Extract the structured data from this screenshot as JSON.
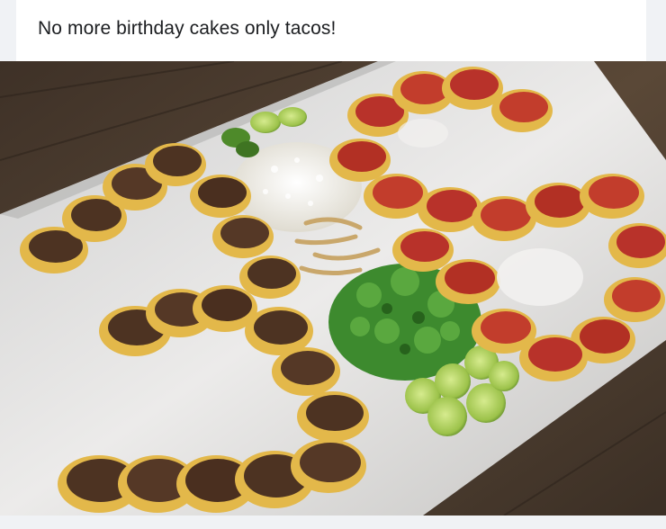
{
  "post": {
    "caption": "No more birthday cakes only tacos!"
  },
  "photo": {
    "subject": "photo of a tray of tacos",
    "colors": {
      "table": "#4a3a2c",
      "foil": "#d9d8d6",
      "tortilla": "#e3b84a",
      "carne_asada": "#4d3322",
      "al_pastor": "#b8322a",
      "cilantro": "#3d8a2e",
      "onion": "#f3f1ea",
      "lime": "#a8c94a"
    }
  }
}
